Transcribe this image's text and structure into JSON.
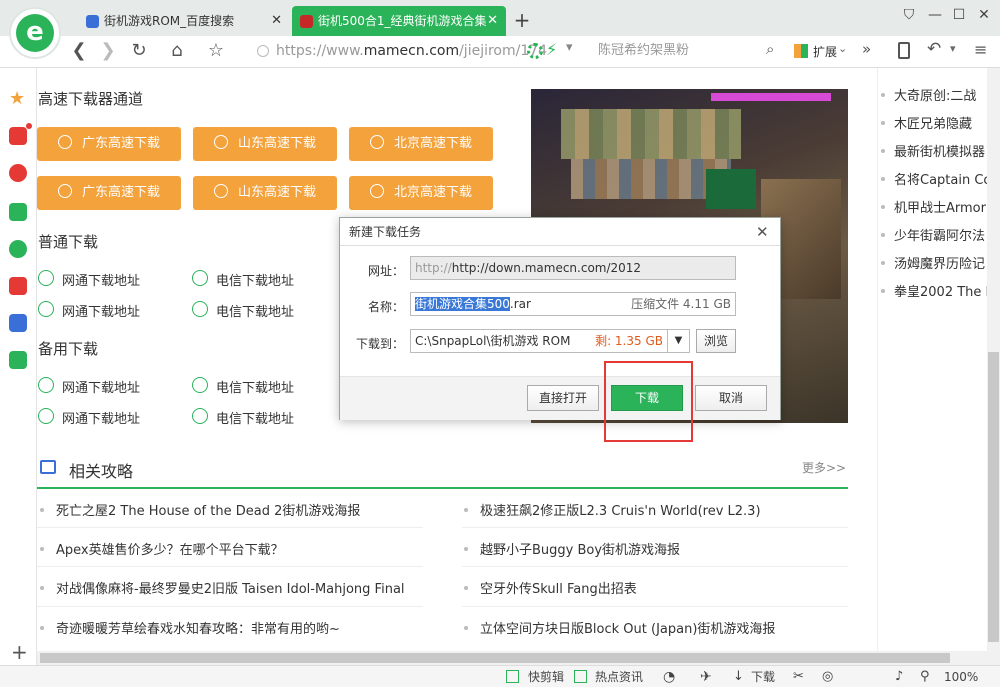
{
  "browser": {
    "tabs": [
      {
        "label": "街机游戏ROM_百度搜索",
        "active": false
      },
      {
        "label": "街机500合1_经典街机游戏合集",
        "active": true
      }
    ],
    "url_prefix": "https://www.",
    "url_host": "mamecn.com",
    "url_path": "/jiejirom/174",
    "search_text": "陈冠希约架黑粉",
    "ext_label": "扩展"
  },
  "sections": {
    "high_speed_title": "高速下载器通道",
    "high_speed_buttons": [
      "广东高速下载",
      "山东高速下载",
      "北京高速下载",
      "广东高速下载",
      "山东高速下载",
      "北京高速下载"
    ],
    "normal_title": "普通下载",
    "normal_links": [
      "网通下载地址",
      "电信下载地址",
      "网通下载地址",
      "电信下载地址"
    ],
    "backup_title": "备用下载",
    "backup_links": [
      "网通下载地址",
      "电信下载地址",
      "网通下载地址",
      "电信下载地址"
    ],
    "related_title": "相关攻略",
    "more_label": "更多>>"
  },
  "articles_left": [
    "死亡之屋2 The House of the Dead 2街机游戏海报",
    "Apex英雄售价多少？在哪个平台下载？",
    "对战偶像麻将-最终罗曼史2旧版 Taisen Idol-Mahjong Final",
    "奇迹暖暖芳草绘春戏水知春攻略：非常有用的哟~"
  ],
  "articles_right": [
    "极速狂飙2修正版L2.3 Cruis'n World(rev L2.3)",
    "越野小子Buggy Boy街机游戏海报",
    "空牙外传Skull Fang出招表",
    "立体空间方块日版Block Out (Japan)街机游戏海报"
  ],
  "right_panel": [
    "大奇原创:二战",
    "木匠兄弟隐藏",
    "最新街机模拟器",
    "名将Captain Co",
    "机甲战士Armor",
    "少年街霸阿尔法",
    "汤姆魔界历险记",
    "拳皇2002 The K"
  ],
  "dialog": {
    "title": "新建下载任务",
    "url_label": "网址：",
    "url_value": "http://down.mamecn.com/2012",
    "name_label": "名称：",
    "name_selected": "街机游戏合集500",
    "name_ext": ".rar",
    "file_info": "压缩文件 4.11 GB",
    "path_label": "下载到：",
    "path_value": "C:\\SnpapLol\\街机游戏 ROM",
    "remaining": "剩: 1.35 GB",
    "browse": "浏览",
    "open_direct": "直接打开",
    "download": "下载",
    "cancel": "取消"
  },
  "status_bar": {
    "quick_edit": "快剪辑",
    "hot_info": "热点资讯",
    "download": "下载",
    "zoom": "100%"
  },
  "colors": {
    "accent_green": "#2bb35a",
    "orange": "#f3a23c",
    "highlight_red": "#e53935"
  }
}
